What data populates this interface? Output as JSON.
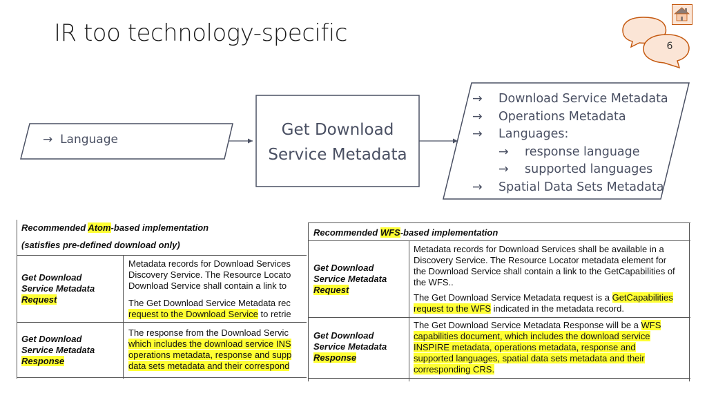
{
  "slide": {
    "title": "IR too technology-specific",
    "page_number": "6"
  },
  "diagram": {
    "input": {
      "arrow": "→",
      "label": "Language"
    },
    "process": {
      "line1": "Get Download",
      "line2": "Service Metadata"
    },
    "output": {
      "items": [
        {
          "arrow": "→",
          "label": "Download Service Metadata",
          "level": 0
        },
        {
          "arrow": "→",
          "label": "Operations Metadata",
          "level": 0
        },
        {
          "arrow": "→",
          "label": "Languages:",
          "level": 0
        },
        {
          "arrow": "→",
          "label": "response language",
          "level": 1
        },
        {
          "arrow": "→",
          "label": "supported languages",
          "level": 1
        },
        {
          "arrow": "→",
          "label": "Spatial Data Sets Metadata",
          "level": 0
        }
      ]
    }
  },
  "atom_table": {
    "header_pre": "Recommended ",
    "header_hl": "Atom",
    "header_post": "-based implementation",
    "subheader": "(satisfies pre-defined download only)",
    "rows": [
      {
        "label1": "Get Download",
        "label2": "Service Metadata",
        "label_hl": "Request",
        "p1": [
          "Metadata records for Download Services",
          "Discovery Service. The Resource Locato",
          "Download Service shall contain a link to"
        ],
        "p2_line1": "The Get Download Service Metadata rec",
        "p2_hl": "request to the Download Service",
        "p2_post": " to retrie"
      },
      {
        "label1": "Get Download",
        "label2": "Service Metadata",
        "label_hl": "Response",
        "p1_line1": "The response from the Download Servic",
        "p1_hl": [
          "which includes the download service INS",
          "operations metadata, response and supp",
          "data sets metadata and their correspond"
        ]
      }
    ]
  },
  "wfs_table": {
    "header_pre": "Recommended ",
    "header_hl": "WFS",
    "header_post": "-based implementation",
    "rows": [
      {
        "label1": "Get Download",
        "label2": "Service Metadata",
        "label_hl": "Request",
        "p1": [
          "Metadata records for Download Services shall be available in a",
          "Discovery Service. The Resource Locator metadata element for",
          "the Download Service shall contain a link to the GetCapabilities of",
          "the WFS.."
        ],
        "p2_pre": "The Get Download Service Metadata request is a ",
        "p2_hl1": "GetCapabilities",
        "p2_hl2": "request to the WFS",
        "p2_post": " indicated in the metadata record."
      },
      {
        "label1": "Get Download",
        "label2": "Service Metadata",
        "label_hl": "Response",
        "p1_pre": "The Get Download Service Metadata Response will be a ",
        "p1_hl_first": "WFS",
        "p1_hl": [
          "capabilities document, which includes the download service",
          "INSPIRE metadata, operations metadata, response and",
          "supported languages, spatial data sets metadata and their",
          "corresponding CRS."
        ]
      }
    ]
  },
  "colors": {
    "diagram_stroke": "#4a5063",
    "highlight": "#ffff33",
    "badge_fill": "#fbe5d6",
    "badge_stroke": "#c55a11"
  }
}
